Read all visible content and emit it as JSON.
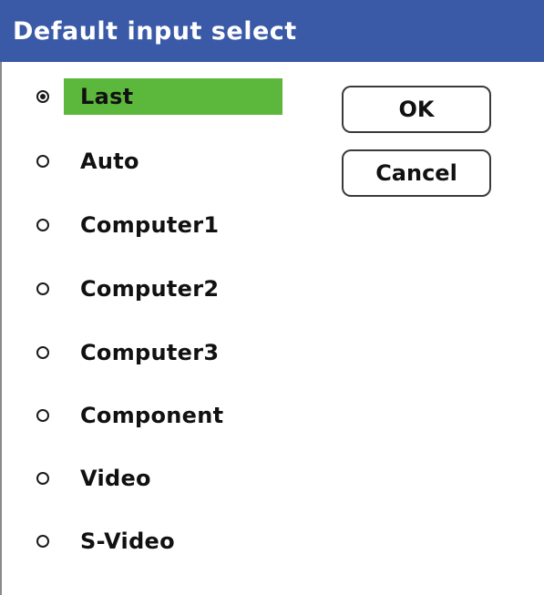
{
  "dialog": {
    "title": "Default input select",
    "title_bar_color": "#3a5aa8",
    "selected_highlight_color": "#5cb83c"
  },
  "options": [
    {
      "label": "Last",
      "selected": true
    },
    {
      "label": "Auto",
      "selected": false
    },
    {
      "label": "Computer1",
      "selected": false
    },
    {
      "label": "Computer2",
      "selected": false
    },
    {
      "label": "Computer3",
      "selected": false
    },
    {
      "label": "Component",
      "selected": false
    },
    {
      "label": "Video",
      "selected": false
    },
    {
      "label": "S-Video",
      "selected": false
    }
  ],
  "buttons": {
    "ok_label": "OK",
    "cancel_label": "Cancel"
  }
}
